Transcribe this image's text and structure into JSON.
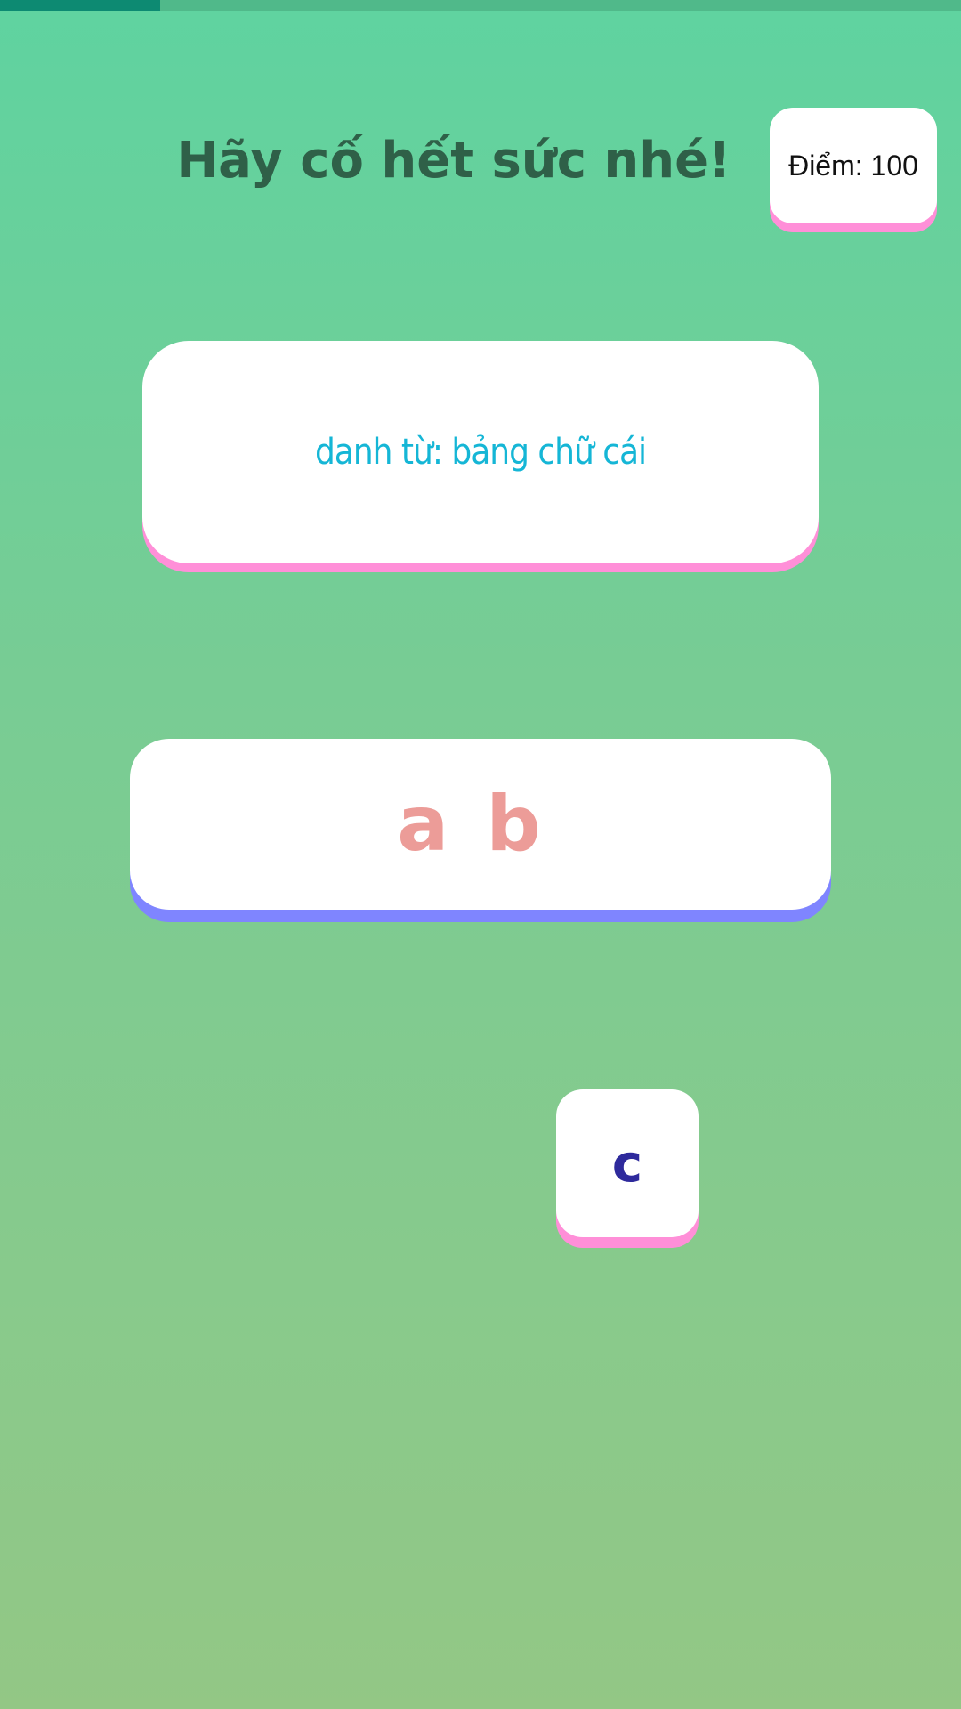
{
  "progress": {
    "fraction": 0.167
  },
  "header": {
    "title": "Hãy cố hết sức nhé!"
  },
  "score": {
    "label": "Điểm: 100"
  },
  "question": {
    "text": "danh từ: bảng chữ cái"
  },
  "answer": {
    "text": "a b"
  },
  "tiles": [
    {
      "letter": "c"
    }
  ],
  "colors": {
    "progress_fill": "#0d8a72",
    "title": "#2f6048",
    "question_text": "#15b6d6",
    "answer_text": "#ec9c98",
    "tile_letter": "#2e2a9c",
    "card_shadow_pink": "#ff8fd8",
    "card_shadow_blue": "#7f85ff"
  }
}
